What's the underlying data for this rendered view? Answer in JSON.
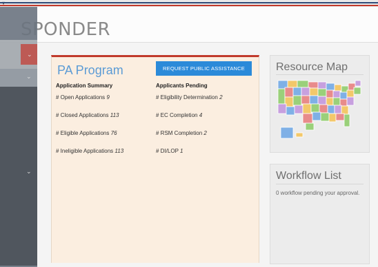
{
  "app": {
    "title_fragment": "SPONDER"
  },
  "pa_program": {
    "title": "PA Program",
    "request_button": "REQUEST PUBLIC ASSISTANCE",
    "summary_heading": "Application Summary",
    "summary": [
      {
        "label": "# Open Applications",
        "value": "9"
      },
      {
        "label": "# Closed Applications",
        "value": "113"
      },
      {
        "label": "# Eligible Applications",
        "value": "76"
      },
      {
        "label": "# Ineligible Applications",
        "value": "113"
      }
    ],
    "pending_heading": "Applicants Pending",
    "pending": [
      {
        "label": "# Eligibility Determination",
        "value": "2"
      },
      {
        "label": "# EC Completion",
        "value": "4"
      },
      {
        "label": "# RSM Completion",
        "value": "2"
      },
      {
        "label": "# DI/LOP",
        "value": "1"
      }
    ]
  },
  "resource_map": {
    "title": "Resource Map"
  },
  "workflow": {
    "title": "Workflow List",
    "text": "0 workflow pending your approval."
  },
  "colors": {
    "accent_blue": "#2b8ad9",
    "title_blue": "#5b9bd5",
    "accent_red": "#c0392b",
    "card_bg": "#fbeee0"
  }
}
